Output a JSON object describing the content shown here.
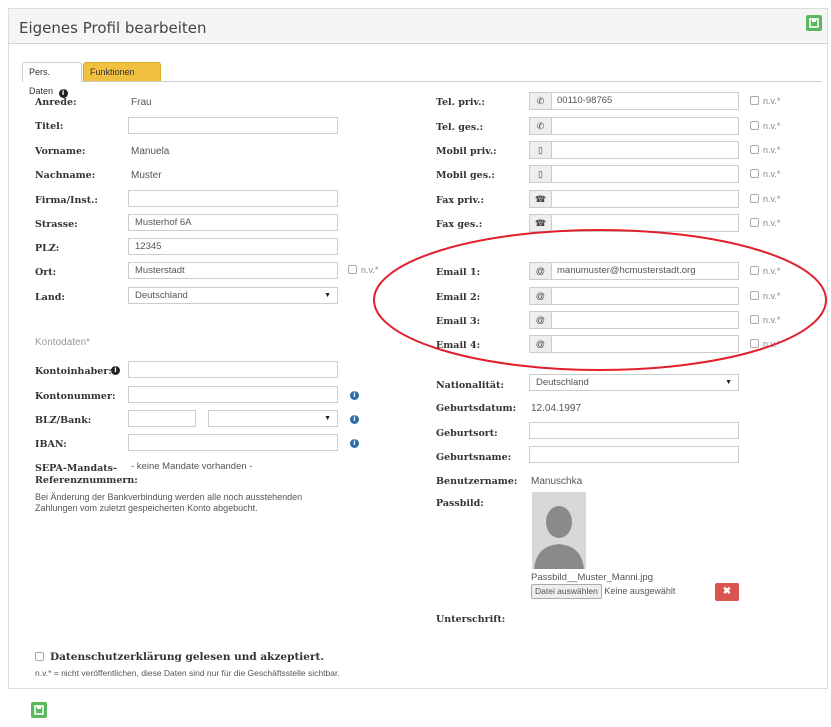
{
  "header": {
    "title": "Eigenes Profil bearbeiten"
  },
  "tabs": [
    {
      "label": "Pers. Daten"
    },
    {
      "label": "Funktionen"
    }
  ],
  "left": {
    "anrede": {
      "label": "Anrede:",
      "value": "Frau"
    },
    "titel": {
      "label": "Titel:",
      "value": ""
    },
    "vorname": {
      "label": "Vorname:",
      "value": "Manuela"
    },
    "nachname": {
      "label": "Nachname:",
      "value": "Muster"
    },
    "firma": {
      "label": "Firma/Inst.:",
      "value": ""
    },
    "strasse": {
      "label": "Strasse:",
      "value": "Musterhof 6A"
    },
    "plz": {
      "label": "PLZ:",
      "value": "12345"
    },
    "ort": {
      "label": "Ort:",
      "value": "Musterstadt",
      "nv": "n.v.*"
    },
    "land": {
      "label": "Land:",
      "value": "Deutschland"
    }
  },
  "konto": {
    "section_title": "Kontodaten*",
    "inhaber": {
      "label": "Kontoinhaber:",
      "value": ""
    },
    "nummer": {
      "label": "Kontonummer:",
      "value": ""
    },
    "blz": {
      "label": "BLZ/Bank:",
      "value": ""
    },
    "iban": {
      "label": "IBAN:",
      "value": ""
    },
    "sepa": {
      "label_line1": "SEPA-Mandats-",
      "label_line2": "Referenznummern:",
      "value": "- keine Mandate vorhanden -"
    },
    "note_line1": "Bei Änderung der Bankverbindung werden alle noch ausstehenden",
    "note_line2": "Zahlungen vom zuletzt gespeicherten Konto abgebucht."
  },
  "right": {
    "tel_priv": {
      "label": "Tel. priv.:",
      "value": "00110-98765",
      "nv": "n.v.*"
    },
    "tel_ges": {
      "label": "Tel. ges.:",
      "value": "",
      "nv": "n.v.*"
    },
    "mobil_priv": {
      "label": "Mobil priv.:",
      "value": "",
      "nv": "n.v.*"
    },
    "mobil_ges": {
      "label": "Mobil ges.:",
      "value": "",
      "nv": "n.v.*"
    },
    "fax_priv": {
      "label": "Fax priv.:",
      "value": "",
      "nv": "n.v.*"
    },
    "fax_ges": {
      "label": "Fax ges.:",
      "value": "",
      "nv": "n.v.*"
    },
    "email1": {
      "label": "Email 1:",
      "value": "manumuster@hcmusterstadt.org",
      "nv": "n.v.*"
    },
    "email2": {
      "label": "Email 2:",
      "value": "",
      "nv": "n.v.*"
    },
    "email3": {
      "label": "Email 3:",
      "value": "",
      "nv": "n.v.*"
    },
    "email4": {
      "label": "Email 4:",
      "value": "",
      "nv": "n.v.*"
    },
    "nationalitaet": {
      "label": "Nationalität:",
      "value": "Deutschland"
    },
    "geburtsdatum": {
      "label": "Geburtsdatum:",
      "value": "12.04.1997"
    },
    "geburtsort": {
      "label": "Geburtsort:",
      "value": ""
    },
    "geburtsname": {
      "label": "Geburtsname:",
      "value": ""
    },
    "benutzername": {
      "label": "Benutzername:",
      "value": "Manuschka"
    },
    "passbild": {
      "label": "Passbild:",
      "filename": "Passbild__Muster_Manni.jpg",
      "file_button": "Datei auswählen",
      "file_status": "Keine ausgewählt"
    },
    "unterschrift": {
      "label": "Unterschrift:"
    }
  },
  "footer": {
    "privacy": "Datenschutzerklärung gelesen und akzeptiert.",
    "note": "n.v.* = nicht veröffentlichen, diese Daten sind nur für die Geschäftsstelle sichtbar."
  },
  "colors": {
    "save": "#5cb85c",
    "tab_active": "#f0c040",
    "delete": "#d9534f",
    "annotation": "#e0202a"
  }
}
